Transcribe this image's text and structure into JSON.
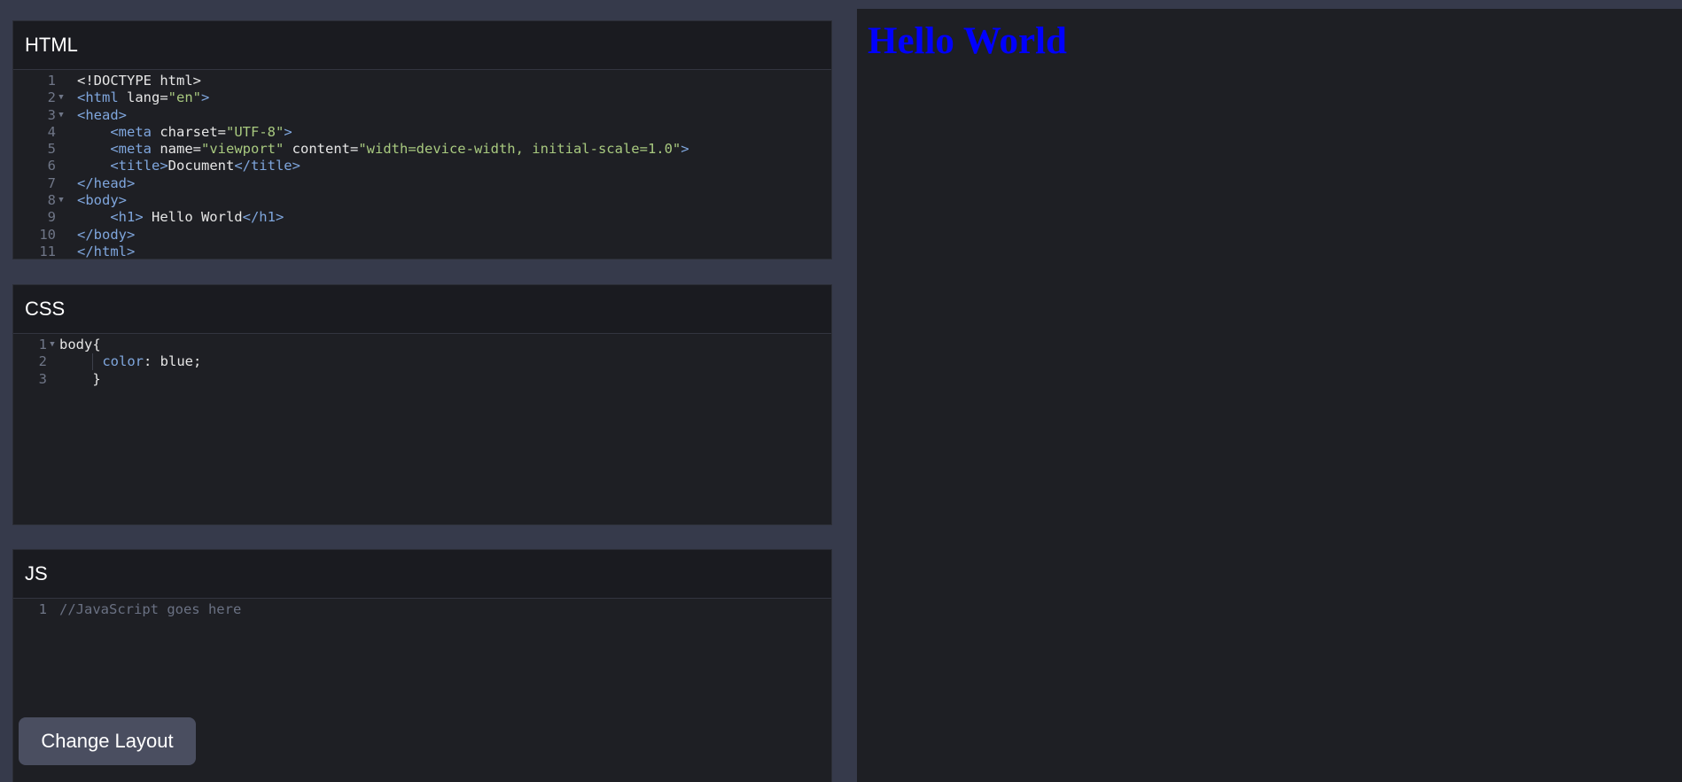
{
  "panels": {
    "html": {
      "title": "HTML"
    },
    "css": {
      "title": "CSS"
    },
    "js": {
      "title": "JS"
    }
  },
  "html_code": {
    "l1": "<!DOCTYPE html>",
    "l2_open": "<html",
    "l2_attr": " lang=",
    "l2_val": "\"en\"",
    "l2_close": ">",
    "l3": "<head>",
    "l4_open": "<meta",
    "l4_attr": " charset=",
    "l4_val": "\"UTF-8\"",
    "l4_close": ">",
    "l5_open": "<meta",
    "l5_attr1": " name=",
    "l5_val1": "\"viewport\"",
    "l5_attr2": " content=",
    "l5_val2": "\"width=device-width, initial-scale=1.0\"",
    "l5_close": ">",
    "l6_open": "<title>",
    "l6_text": "Document",
    "l6_close": "</title>",
    "l7": "</head>",
    "l8": "<body>",
    "l9_open": "<h1>",
    "l9_text": " Hello World",
    "l9_close": "</h1>",
    "l10": "</body>",
    "l11": "</html>"
  },
  "css_code": {
    "l1": "body{",
    "l2_prop": "color",
    "l2_rest": ": blue;",
    "l3": "}"
  },
  "js_code": {
    "l1": "//JavaScript goes here"
  },
  "line_numbers": [
    "1",
    "2",
    "3",
    "4",
    "5",
    "6",
    "7",
    "8",
    "9",
    "10",
    "11"
  ],
  "preview": {
    "heading": "Hello World"
  },
  "buttons": {
    "change_layout": "Change Layout"
  }
}
